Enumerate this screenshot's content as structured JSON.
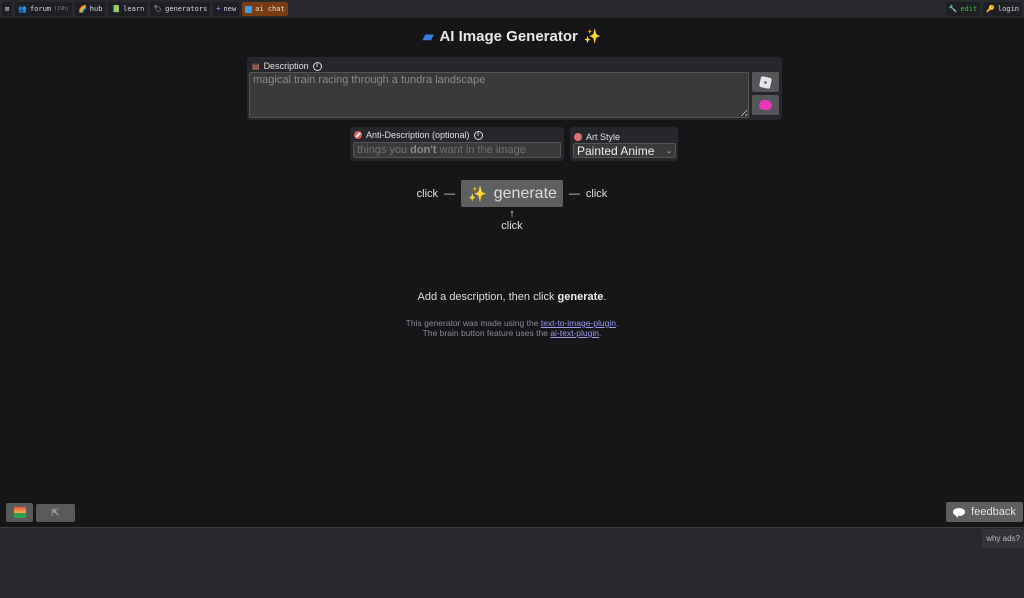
{
  "topbar": {
    "left": [
      {
        "icon": "shuffle-icon",
        "label": ""
      },
      {
        "icon": "forum-icon",
        "label": "forum",
        "count": "(19h)"
      },
      {
        "icon": "rainbow-icon",
        "label": "hub"
      },
      {
        "icon": "learn-icon",
        "label": "learn"
      },
      {
        "icon": "tags-icon",
        "label": "generators"
      },
      {
        "icon": "plus-icon",
        "label": "new"
      },
      {
        "icon": "chat-icon",
        "label": "ai chat"
      }
    ],
    "right": [
      {
        "icon": "wrench-icon",
        "label": "edit"
      },
      {
        "icon": "key-icon",
        "label": "login"
      }
    ]
  },
  "title": "AI Image Generator",
  "description": {
    "label": "Description",
    "value": "magical train racing through a tundra landscape"
  },
  "anti_description": {
    "label": "Anti-Description (optional)",
    "placeholder_pre": "things you",
    "placeholder_bold": "don't",
    "placeholder_post": "want in the image"
  },
  "art_style": {
    "label": "Art Style",
    "selected": "Painted Anime"
  },
  "generate": {
    "label": "generate",
    "click_left": "click",
    "click_right": "click",
    "click_below": "click",
    "arrow_left": "—",
    "arrow_right": "—",
    "arrow_up": "↑"
  },
  "hint": {
    "pre": "Add a description, then click",
    "bold": "generate",
    "post": "."
  },
  "credits": {
    "line1_pre": "This generator was made using the",
    "line1_link": "text-to-image-plugin",
    "line1_post": ".",
    "line2_pre": "The brain button feature uses the",
    "line2_link": "ai-text-plugin",
    "line2_post": "."
  },
  "bottom": {
    "cursor_glyph": "⇱",
    "feedback_label": "feedback",
    "why_ads_label": "why ads?"
  }
}
